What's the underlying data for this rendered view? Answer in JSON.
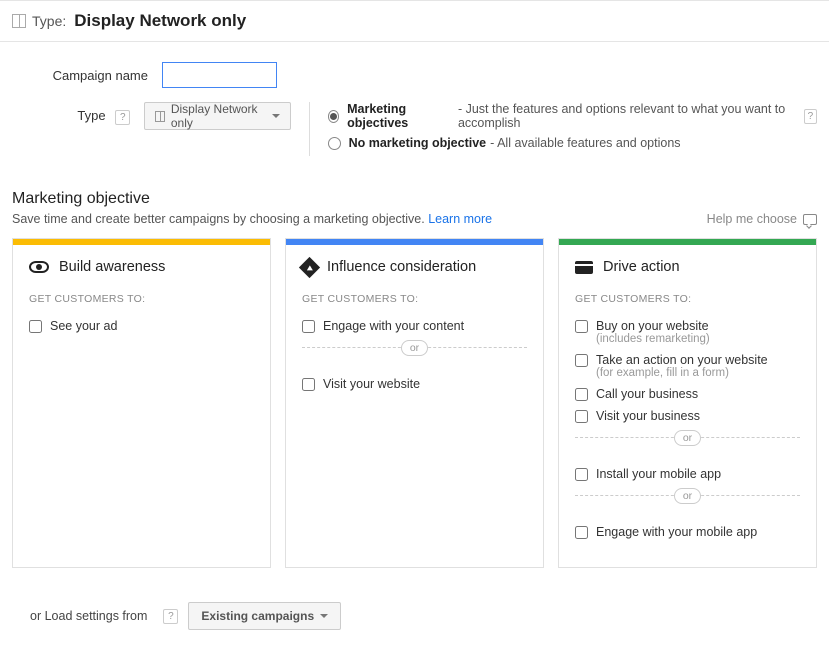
{
  "header": {
    "type_label": "Type:",
    "type_value": "Display Network only"
  },
  "form": {
    "campaign_name_label": "Campaign name",
    "campaign_name_value": "",
    "type_label": "Type",
    "type_dropdown_value": "Display Network only",
    "radios": {
      "marketing_label": "Marketing objectives",
      "marketing_desc": " - Just the features and options relevant to what you want to accomplish",
      "no_marketing_label": "No marketing objective",
      "no_marketing_desc": " - All available features and options"
    }
  },
  "section": {
    "title": "Marketing objective",
    "subtitle": "Save time and create better campaigns by choosing a marketing objective. ",
    "learn_more": "Learn more",
    "help_me_choose": "Help me choose"
  },
  "cards": {
    "get_customers_to": "GET CUSTOMERS TO:",
    "or": "or",
    "awareness": {
      "title": "Build awareness",
      "opt1": "See your ad"
    },
    "consideration": {
      "title": "Influence consideration",
      "opt1": "Engage with your content",
      "opt2": "Visit your website"
    },
    "action": {
      "title": "Drive action",
      "opt1": "Buy on your website ",
      "opt1_secondary": "(includes remarketing)",
      "opt2": "Take an action on your website",
      "opt2_secondary": "(for example, fill in a form)",
      "opt3": "Call your business",
      "opt4": "Visit your business",
      "opt5": "Install your mobile app",
      "opt6": "Engage with your mobile app"
    }
  },
  "footer": {
    "or_load": "or Load settings from",
    "button": "Existing campaigns"
  },
  "help_icon": "?"
}
